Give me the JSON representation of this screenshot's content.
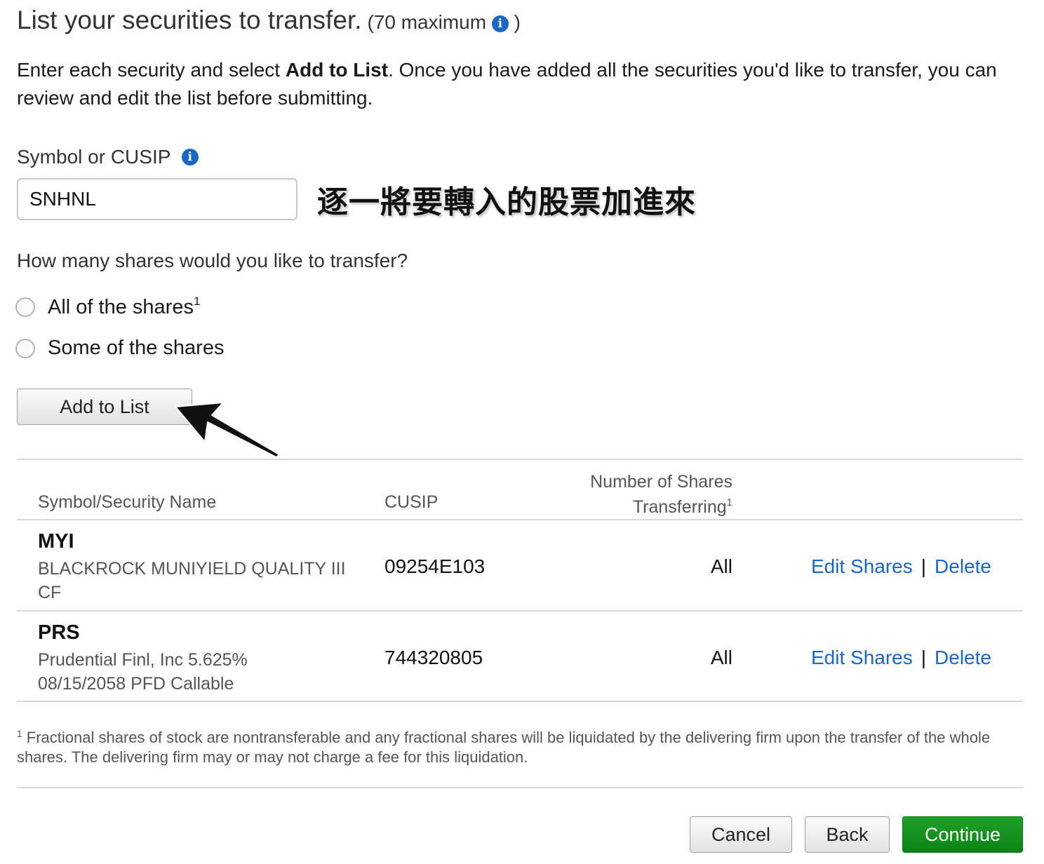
{
  "header": {
    "title": "List your securities to transfer.",
    "max_note_open": "(70 maximum",
    "max_note_close": ")"
  },
  "intro": {
    "part1": "Enter each security and select ",
    "bold": "Add to List",
    "part2": ". Once you have added all the securities you'd like to transfer, you can review and edit the list before submitting."
  },
  "symbol_field": {
    "label": "Symbol or CUSIP",
    "value": "SNHNL"
  },
  "annotation": "逐一將要轉入的股票加進來",
  "shares_question": {
    "label": "How many shares would you like to transfer?",
    "options": [
      {
        "label": "All of the shares",
        "sup": "1"
      },
      {
        "label": "Some of the shares",
        "sup": ""
      }
    ]
  },
  "add_button_label": "Add to List",
  "table": {
    "headers": {
      "symbol": "Symbol/Security Name",
      "cusip": "CUSIP",
      "shares_line1": "Number of Shares",
      "shares_line2": "Transferring",
      "shares_sup": "1"
    },
    "rows": [
      {
        "symbol": "MYI",
        "name": "BLACKROCK MUNIYIELD QUALITY III CF",
        "cusip": "09254E103",
        "shares": "All",
        "edit": "Edit Shares",
        "sep": "|",
        "delete": "Delete"
      },
      {
        "symbol": "PRS",
        "name": "Prudential Finl, Inc 5.625% 08/15/2058 PFD Callable",
        "cusip": "744320805",
        "shares": "All",
        "edit": "Edit Shares",
        "sep": "|",
        "delete": "Delete"
      }
    ]
  },
  "footnote": {
    "sup": "1",
    "text": "Fractional shares of stock are nontransferable and any fractional shares will be liquidated by the delivering firm upon the transfer of the whole shares. The delivering firm may or may not charge a fee for this liquidation."
  },
  "buttons": {
    "cancel": "Cancel",
    "back": "Back",
    "continue": "Continue"
  },
  "colors": {
    "link": "#1967c6",
    "continue_bg": "#0a8414",
    "info_icon": "#1967c6"
  },
  "icons": {
    "info": "info-icon",
    "annotation_arrow": "arrow-icon"
  }
}
